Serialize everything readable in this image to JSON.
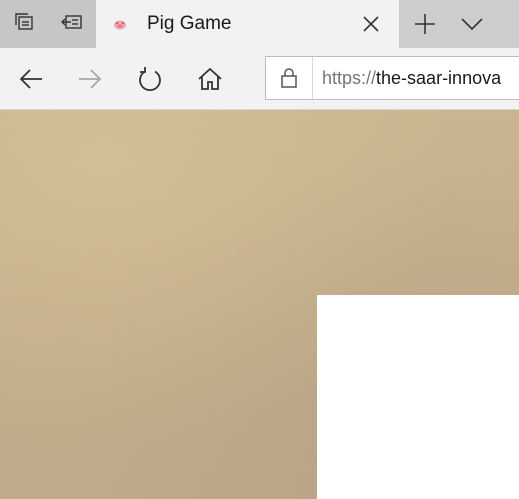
{
  "browser": {
    "tab": {
      "title": "Pig Game",
      "favicon": "pig-icon"
    },
    "tabstrip_icons": {
      "set_aside": "tabs-aside-icon",
      "restore": "restore-tabs-icon",
      "close": "close-icon",
      "new_tab": "plus-icon",
      "tab_list": "chevron-down-icon"
    },
    "toolbar_icons": {
      "back": "arrow-left-icon",
      "forward": "arrow-right-icon",
      "refresh": "refresh-icon",
      "home": "home-icon",
      "lock": "lock-icon"
    },
    "address": {
      "scheme": "https://",
      "rest": "the-saar-innova"
    }
  },
  "colors": {
    "tabstrip_bg": "#cdcdcd",
    "active_tab_bg": "#f2f2f2",
    "page_bg": "#c4af8c",
    "board_bg": "#ffffff",
    "favicon": "#f4a6b0"
  }
}
